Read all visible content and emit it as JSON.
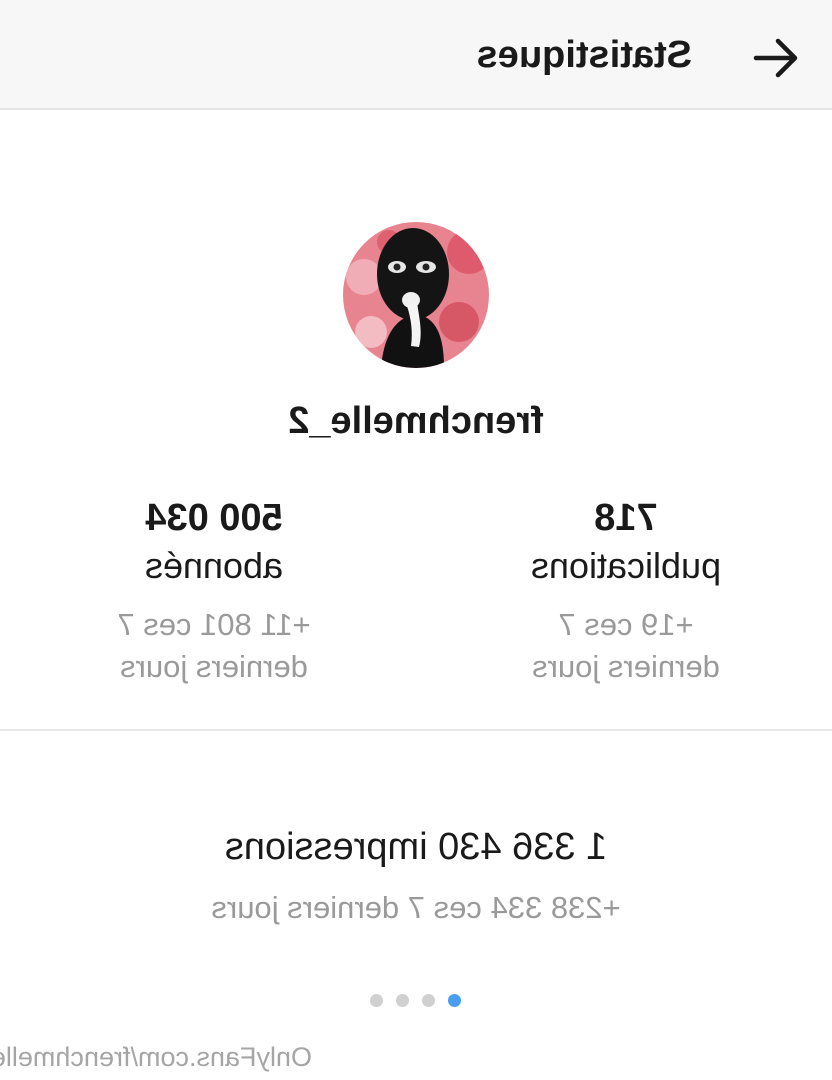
{
  "header": {
    "title": "Statistiques",
    "back_icon": "arrow-right-icon"
  },
  "profile": {
    "username": "frenchmelle_2",
    "avatar": "masked-person-avatar"
  },
  "stats": [
    {
      "value": "500 034",
      "label": "abonnés",
      "change": "+11 801 ces 7",
      "change_suffix": "derniers jours"
    },
    {
      "value": "718",
      "label": "publications",
      "change": "+19 ces 7",
      "change_suffix": "derniers jours"
    }
  ],
  "impressions": {
    "value": "1 336 430 impressions",
    "change": "+238 334 ces 7 derniers jours"
  },
  "pagination": {
    "count": 4,
    "active_index": 3
  },
  "watermark": "OnlyFans.com/frenchmelle",
  "colors": {
    "header_bg": "#f7f7f7",
    "text": "#1a1a1a",
    "muted_text": "#9a9a9a",
    "active_dot": "#4a9ef0",
    "inactive_dot": "#d0d0d0"
  }
}
